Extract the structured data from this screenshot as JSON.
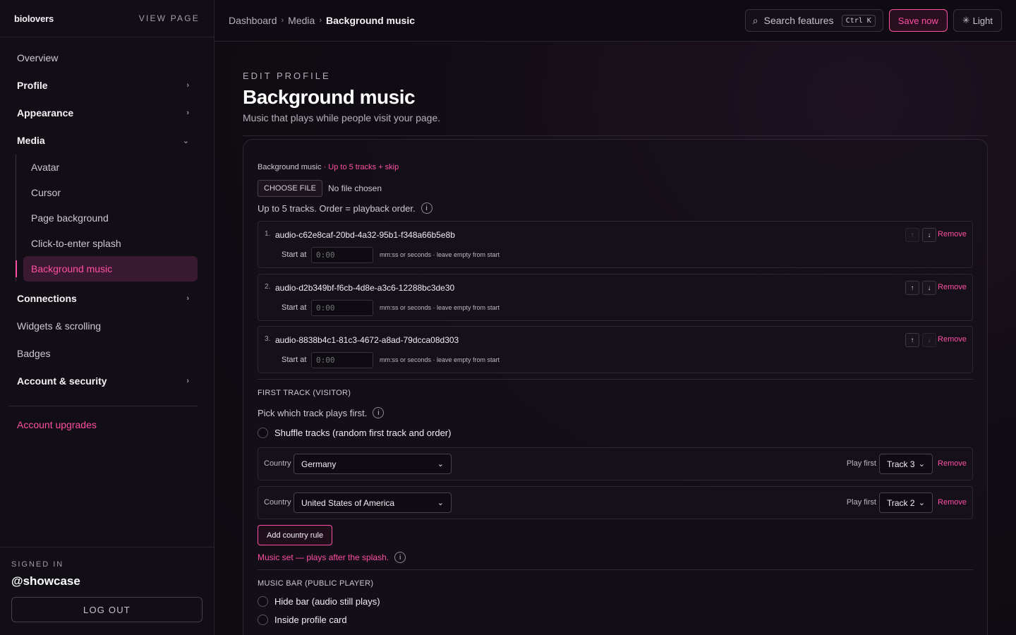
{
  "sidebar": {
    "brand": "biolovers",
    "view_page": "VIEW PAGE",
    "items": [
      {
        "label": "Overview"
      },
      {
        "label": "Profile",
        "chevron": "›"
      },
      {
        "label": "Appearance",
        "chevron": "›"
      },
      {
        "label": "Media",
        "chevron": "⌄"
      },
      {
        "label": "Connections",
        "chevron": "›"
      },
      {
        "label": "Widgets & scrolling"
      },
      {
        "label": "Badges"
      },
      {
        "label": "Account & security",
        "chevron": "›"
      }
    ],
    "media_sub": [
      {
        "label": "Avatar"
      },
      {
        "label": "Cursor"
      },
      {
        "label": "Page background"
      },
      {
        "label": "Click-to-enter splash"
      },
      {
        "label": "Background music"
      }
    ],
    "upgrades": "Account upgrades",
    "signed_in_label": "SIGNED IN",
    "handle": "@showcase",
    "logout": "LOG OUT"
  },
  "topbar": {
    "crumbs": [
      "Dashboard",
      "Media",
      "Background music"
    ],
    "crumb_sep": "›",
    "search_label": "Search features",
    "search_kbd": "Ctrl K",
    "search_icon": "⌕",
    "save": "Save now",
    "light": "Light",
    "light_icon": "✳"
  },
  "header": {
    "eyebrow": "EDIT PROFILE",
    "title": "Background music",
    "subtitle": "Music that plays while people visit your page."
  },
  "music": {
    "label": "Background music",
    "label_note": "· Up to 5 tracks + skip",
    "choose": "CHOOSE FILE",
    "nofile": "No file chosen",
    "hint": "Up to 5 tracks. Order = playback order.",
    "info_icon": "i",
    "start_label": "Start at",
    "start_value": "0:00",
    "start_format": "mm:ss or seconds · leave empty from start",
    "remove": "Remove",
    "up_icon": "↑",
    "down_icon": "↓",
    "tracks": [
      {
        "num": "1.",
        "name": "audio-c62e8caf-20bd-4a32-95b1-f348a66b5e8b"
      },
      {
        "num": "2.",
        "name": "audio-d2b349bf-f6cb-4d8e-a3c6-12288bc3de30"
      },
      {
        "num": "3.",
        "name": "audio-8838b4c1-81c3-4672-a8ad-79dcca08d303"
      }
    ]
  },
  "first_track": {
    "title": "FIRST TRACK (VISITOR)",
    "hint": "Pick which track plays first.",
    "shuffle": "Shuffle tracks (random first track and order)",
    "country_label": "Country",
    "play_first_label": "Play first",
    "dropdown_icon": "⌄",
    "rules": [
      {
        "country": "Germany",
        "track": "Track 3"
      },
      {
        "country": "United States of America",
        "track": "Track 2"
      }
    ],
    "add_rule": "Add country rule",
    "status": "Music set — plays after the splash."
  },
  "music_bar": {
    "title": "MUSIC BAR (PUBLIC PLAYER)",
    "hide": "Hide bar (audio still plays)",
    "inside": "Inside profile card"
  },
  "colors": {
    "accent": "#ff4fa3",
    "bg": "#0d0a10"
  }
}
